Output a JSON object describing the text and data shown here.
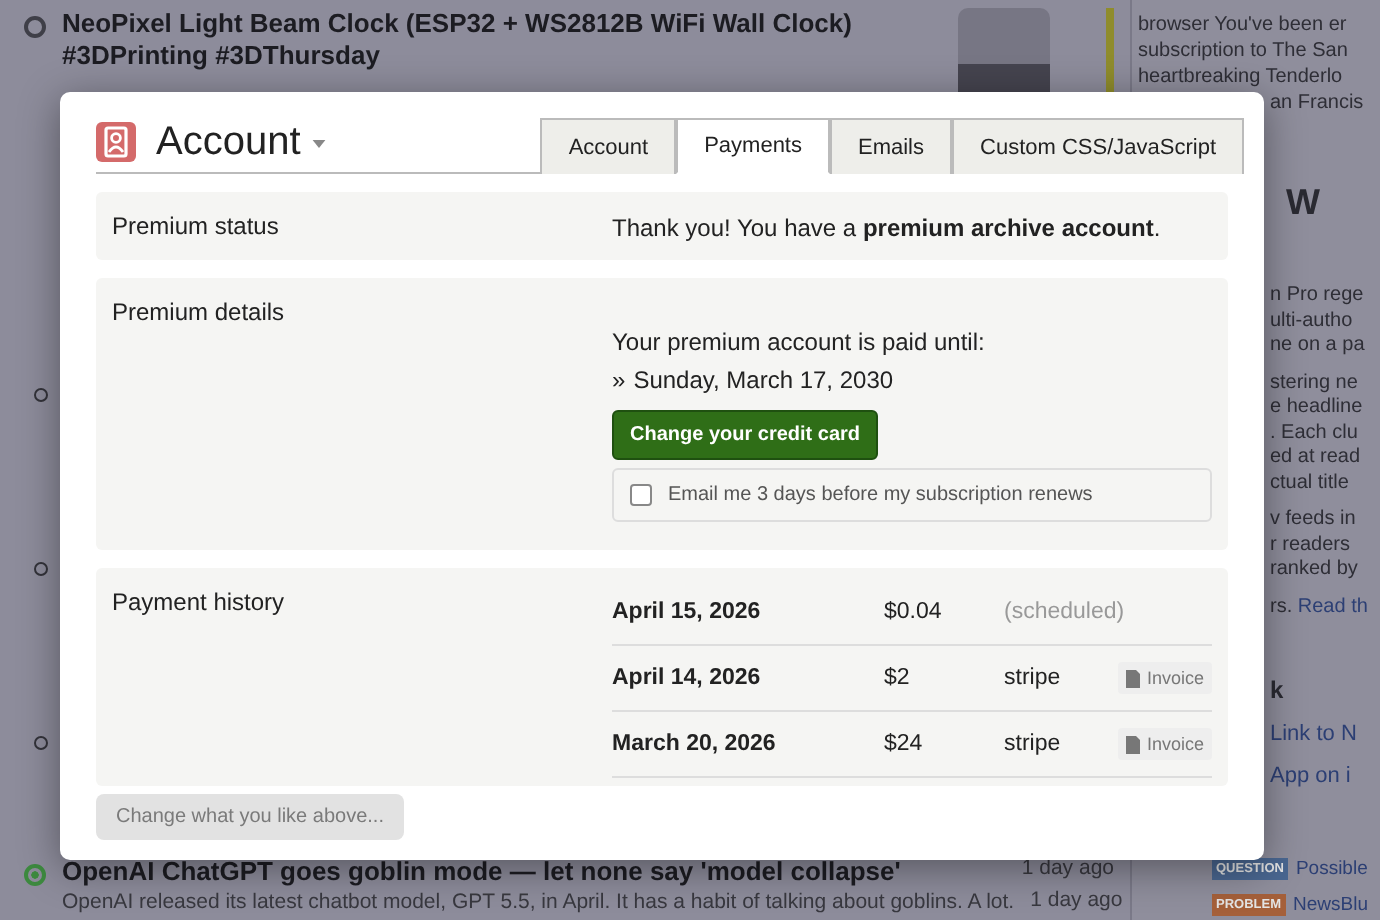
{
  "feed": {
    "stories": [
      {
        "title": "NeoPixel Light Beam Clock (ESP32 + WS2812B WiFi Wall Clock) #3DPrinting #3DThursday",
        "selected": false
      },
      {
        "title": "OpenAI ChatGPT goes goblin mode — let none say 'model collapse'",
        "snippets": [
          "OpenAI released its latest chatbot model, GPT 5.5, in April. It has a habit of talking about goblins. A lot."
        ],
        "time": "1 day ago",
        "selected": true
      }
    ],
    "snippet_time": "1 day ago"
  },
  "sidebar": {
    "top_lines": [
      "browser You've been er",
      "subscription to The San",
      "heartbreaking Tenderlo"
    ],
    "side_line": "an Francis",
    "heading": "W",
    "paragraphs": [
      [
        "n Pro rege",
        "ulti-autho",
        "ne on a pa"
      ],
      [
        "stering ne",
        "e headline",
        ". Each clu",
        "ed at read",
        "ctual title"
      ],
      [
        "v feeds in",
        "r readers",
        "ranked by"
      ]
    ],
    "link_line": {
      "text": "rs.",
      "link": "Read th"
    },
    "section_title": "k",
    "links": [
      "Link to N",
      "App on i"
    ],
    "items": [
      {
        "badge": "QUESTION",
        "color": "#4a6791",
        "title": "Possible"
      },
      {
        "badge": "PROBLEM",
        "color": "#a5603a",
        "title": "NewsBlu"
      }
    ]
  },
  "dialog": {
    "title": "Account",
    "tabs": [
      {
        "label": "Account",
        "selected": false
      },
      {
        "label": "Payments",
        "selected": true
      },
      {
        "label": "Emails",
        "selected": false
      },
      {
        "label": "Custom CSS/JavaScript",
        "selected": false
      }
    ],
    "sections": [
      {
        "kind": "status",
        "label": "Premium status",
        "text": "Thank you! You have a **premium archive account**."
      },
      {
        "kind": "details",
        "label": "Premium details",
        "text": "Your premium account is paid until:",
        "marker": "»",
        "date": "Sunday, March 17, 2030",
        "button": "Change your credit card",
        "checkbox": {
          "label": "Email me 3 days before my subscription renews",
          "checked": false
        }
      },
      {
        "kind": "history",
        "label": "Payment history",
        "payments": [
          {
            "date": "April 15, 2026",
            "amount": "$0.04",
            "method": "(scheduled)",
            "scheduled": true
          },
          {
            "date": "April 14, 2026",
            "amount": "$2",
            "method": "stripe",
            "scheduled": false,
            "invoice": "Invoice"
          },
          {
            "date": "March 20, 2026",
            "amount": "$24",
            "method": "stripe",
            "scheduled": false,
            "invoice": "Invoice"
          }
        ]
      }
    ],
    "save_button": {
      "label": "Change what you like above...",
      "disabled": true
    }
  }
}
